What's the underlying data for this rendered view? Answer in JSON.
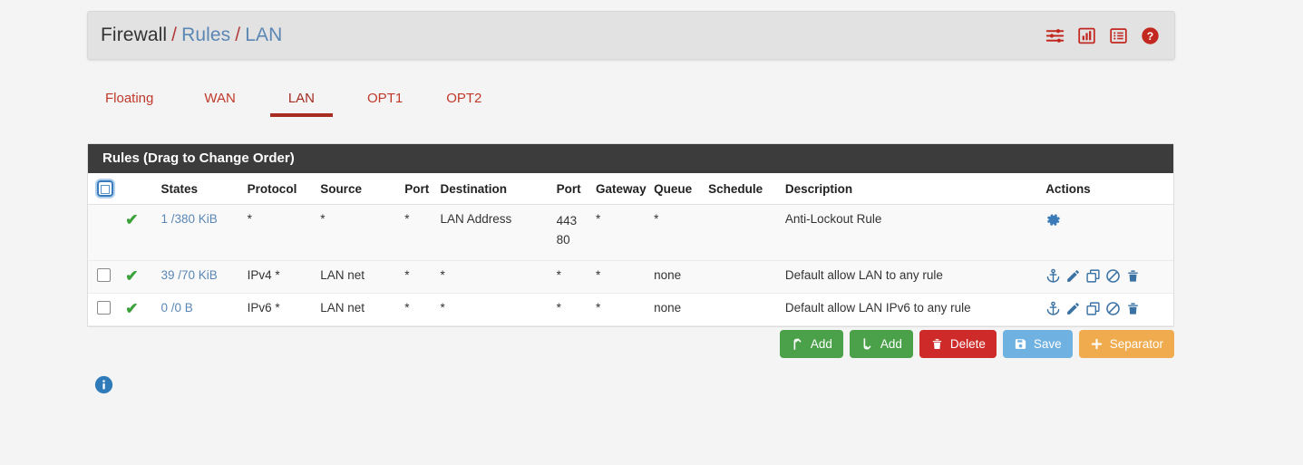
{
  "breadcrumb": {
    "root": "Firewall",
    "sep": "/",
    "level2": "Rules",
    "level3": "LAN"
  },
  "header_icons": [
    {
      "name": "sliders-icon",
      "label": "Advanced Filter"
    },
    {
      "name": "chart-bar-icon",
      "label": "Statistics"
    },
    {
      "name": "list-icon",
      "label": "States"
    },
    {
      "name": "help-circle-icon",
      "label": "Help"
    }
  ],
  "tabs": [
    {
      "label": "Floating",
      "active": false
    },
    {
      "label": "WAN",
      "active": false
    },
    {
      "label": "LAN",
      "active": true
    },
    {
      "label": "OPT1",
      "active": false
    },
    {
      "label": "OPT2",
      "active": false
    }
  ],
  "panel": {
    "title": "Rules (Drag to Change Order)"
  },
  "table": {
    "columns": [
      "",
      "",
      "States",
      "Protocol",
      "Source",
      "Port",
      "Destination",
      "Port",
      "Gateway",
      "Queue",
      "Schedule",
      "Description",
      "Actions"
    ],
    "rows": [
      {
        "has_checkbox": false,
        "status": "✔",
        "states": "1 /380 KiB",
        "protocol": "*",
        "source": "*",
        "port_src": "*",
        "destination": "LAN Address",
        "port_dst_1": "443",
        "port_dst_2": "80",
        "gateway": "*",
        "queue": "*",
        "schedule": "",
        "description": "Anti-Lockout Rule",
        "actions": [
          "gear-icon"
        ]
      },
      {
        "has_checkbox": true,
        "status": "✔",
        "states": "39 /70 KiB",
        "protocol": "IPv4 *",
        "source": "LAN net",
        "port_src": "*",
        "destination": "*",
        "port_dst_1": "*",
        "port_dst_2": "",
        "gateway": "*",
        "queue": "none",
        "schedule": "",
        "description": "Default allow LAN to any rule",
        "actions": [
          "anchor-icon",
          "pencil-icon",
          "copy-icon",
          "ban-icon",
          "trash-icon"
        ]
      },
      {
        "has_checkbox": true,
        "status": "✔",
        "states": "0 /0 B",
        "protocol": "IPv6 *",
        "source": "LAN net",
        "port_src": "*",
        "destination": "*",
        "port_dst_1": "*",
        "port_dst_2": "",
        "gateway": "*",
        "queue": "none",
        "schedule": "",
        "description": "Default allow LAN IPv6 to any rule",
        "actions": [
          "anchor-icon",
          "pencil-icon",
          "copy-icon",
          "ban-icon",
          "trash-icon"
        ]
      }
    ]
  },
  "buttons": [
    {
      "label": "Add",
      "icon": "arrow-up-icon",
      "color": "#4aa14a"
    },
    {
      "label": "Add",
      "icon": "arrow-down-icon",
      "color": "#4aa14a"
    },
    {
      "label": "Delete",
      "icon": "trash-icon",
      "color": "#cf2a2a"
    },
    {
      "label": "Save",
      "icon": "save-icon",
      "color": "#6fb1e0"
    },
    {
      "label": "Separator",
      "icon": "plus-icon",
      "color": "#efab4e"
    }
  ],
  "footer": {
    "info_icon": "info-circle-icon"
  },
  "colors": {
    "accent_red": "#c2281f",
    "link_blue": "#5b87b5",
    "action_blue": "#3b72a4",
    "check_green": "#3ba23b",
    "panel_head": "#3c3c3c",
    "page_bg": "#f4f4f4"
  }
}
